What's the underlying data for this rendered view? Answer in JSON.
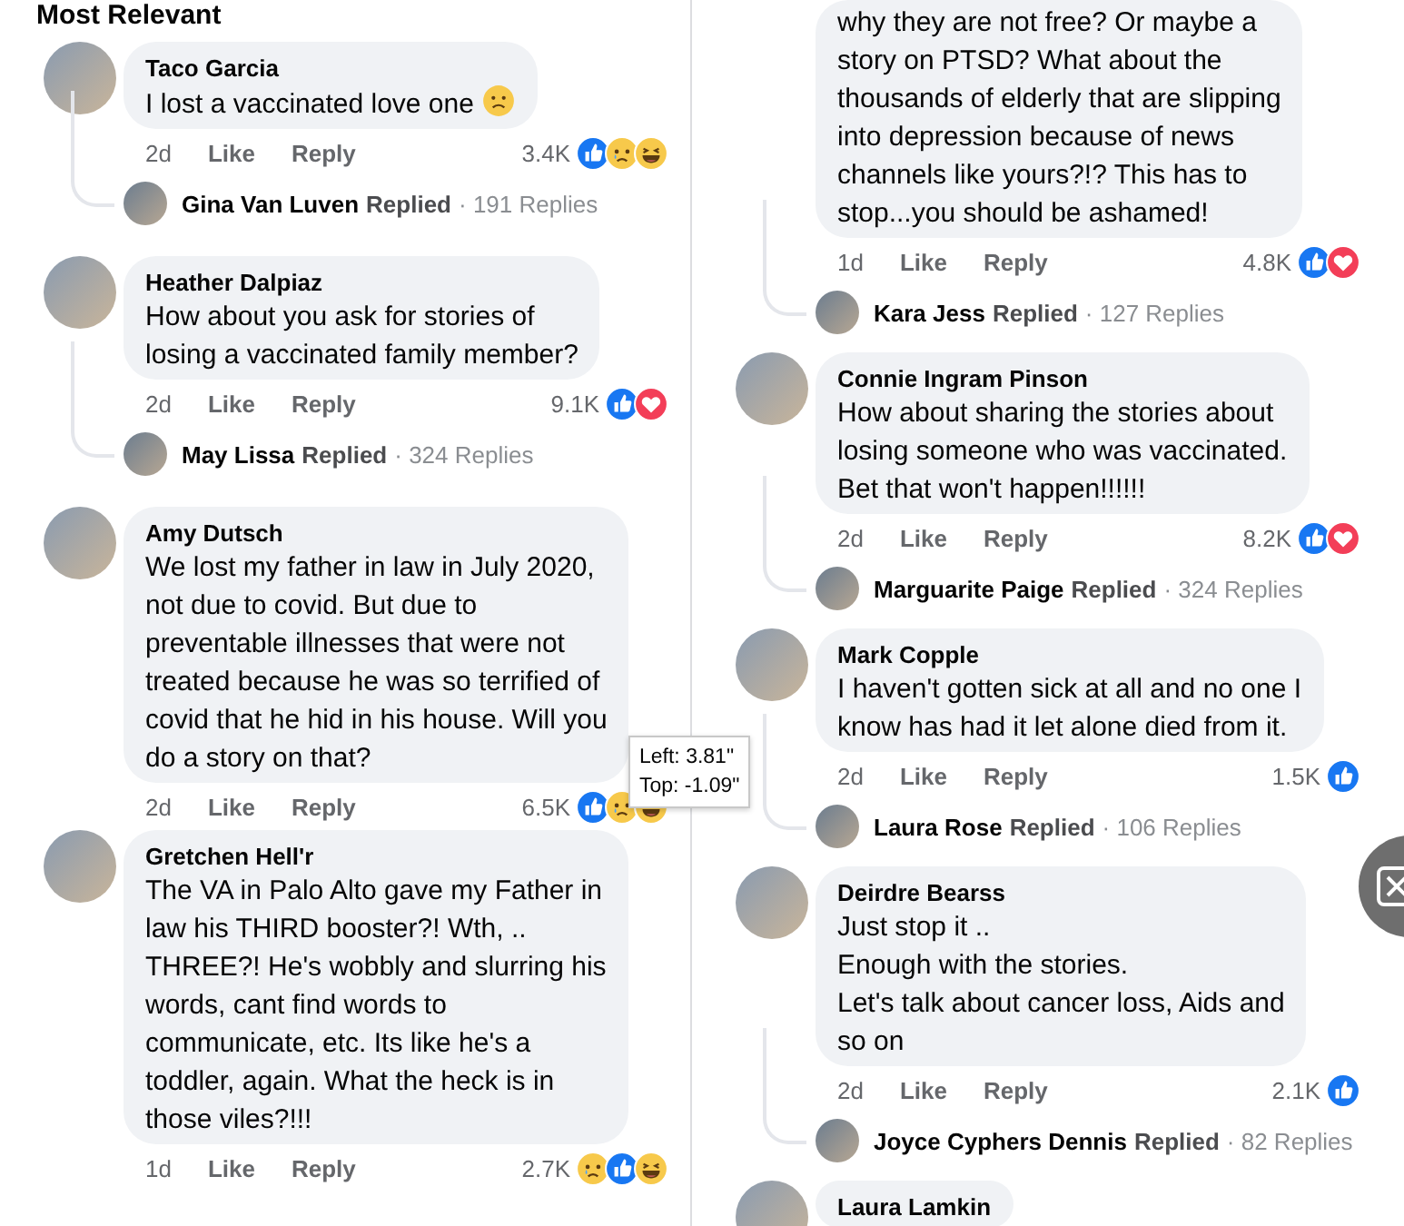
{
  "columns": [
    {
      "header": "Most Relevant",
      "comments": [
        {
          "name": "Taco Garcia",
          "text": "I lost a vaccinated love one",
          "emoji": {
            "kind": "frown"
          },
          "time": "2d",
          "like": "Like",
          "reply": "Reply",
          "count": "3.4K",
          "reactions": [
            {
              "kind": "like"
            },
            {
              "kind": "sad"
            },
            {
              "kind": "haha"
            }
          ],
          "replied": {
            "name": "Gina Van Luven",
            "label": "Replied",
            "replies": "· 191 Replies"
          }
        },
        {
          "name": "Heather Dalpiaz",
          "text": "How about you ask for stories of\nlosing a vaccinated family member?",
          "time": "2d",
          "like": "Like",
          "reply": "Reply",
          "count": "9.1K",
          "reactions": [
            {
              "kind": "like"
            },
            {
              "kind": "love"
            }
          ],
          "replied": {
            "name": "May Lissa",
            "label": "Replied",
            "replies": "· 324 Replies"
          }
        },
        {
          "name": "Amy Dutsch",
          "text": "We lost my father in law in July 2020,\nnot due to covid. But due to\npreventable illnesses that were not\ntreated because he was so terrified of\ncovid that he hid in his house. Will you\ndo a story on that?",
          "time": "2d",
          "like": "Like",
          "reply": "Reply",
          "count": "6.5K",
          "reactions": [
            {
              "kind": "like"
            },
            {
              "kind": "sad"
            },
            {
              "kind": "haha"
            }
          ]
        },
        {
          "name": "Gretchen Hell'r",
          "text": "The VA in Palo Alto gave my Father in\nlaw his THIRD booster?! Wth, ..\nTHREE?! He's wobbly and slurring his\nwords, cant find words to\ncommunicate, etc. Its like he's a\ntoddler, again. What the heck is in\nthose viles?!!!",
          "time": "1d",
          "like": "Like",
          "reply": "Reply",
          "count": "2.7K",
          "reactions": [
            {
              "kind": "sad"
            },
            {
              "kind": "like"
            },
            {
              "kind": "haha"
            }
          ]
        }
      ]
    },
    {
      "comments": [
        {
          "text": "why they are not free? Or maybe a\nstory on PTSD? What about the\nthousands of elderly that are slipping\ninto depression because of news\nchannels like yours?!? This has to\nstop...you should be ashamed!",
          "time": "1d",
          "like": "Like",
          "reply": "Reply",
          "count": "4.8K",
          "reactions": [
            {
              "kind": "like"
            },
            {
              "kind": "love"
            }
          ],
          "replied": {
            "name": "Kara Jess",
            "label": "Replied",
            "replies": "· 127 Replies"
          }
        },
        {
          "name": "Connie Ingram Pinson",
          "text": "How about sharing the stories about\nlosing someone who was vaccinated.\nBet that won't happen!!!!!!",
          "time": "2d",
          "like": "Like",
          "reply": "Reply",
          "count": "8.2K",
          "reactions": [
            {
              "kind": "like"
            },
            {
              "kind": "love"
            }
          ],
          "replied": {
            "name": "Marguarite Paige",
            "label": "Replied",
            "replies": "· 324 Replies"
          }
        },
        {
          "name": "Mark Copple",
          "text": "I haven't gotten sick at all and no one I\nknow has had it let alone died from it.",
          "time": "2d",
          "like": "Like",
          "reply": "Reply",
          "count": "1.5K",
          "reactions": [
            {
              "kind": "like"
            }
          ],
          "replied": {
            "name": "Laura Rose",
            "label": "Replied",
            "replies": "· 106 Replies"
          }
        },
        {
          "name": "Deirdre Bearss",
          "text": "Just stop it ..\nEnough with the stories.\nLet's talk about cancer loss,  Aids  and\nso on",
          "time": "2d",
          "like": "Like",
          "reply": "Reply",
          "count": "2.1K",
          "reactions": [
            {
              "kind": "like"
            }
          ],
          "replied": {
            "name": "Joyce Cyphers Dennis",
            "label": "Replied",
            "replies": "· 82 Replies"
          }
        },
        {
          "name": "Laura Lamkin"
        }
      ]
    }
  ],
  "tooltip": {
    "lines": [
      "Left: 3.81\"",
      "Top: -1.09\""
    ]
  }
}
